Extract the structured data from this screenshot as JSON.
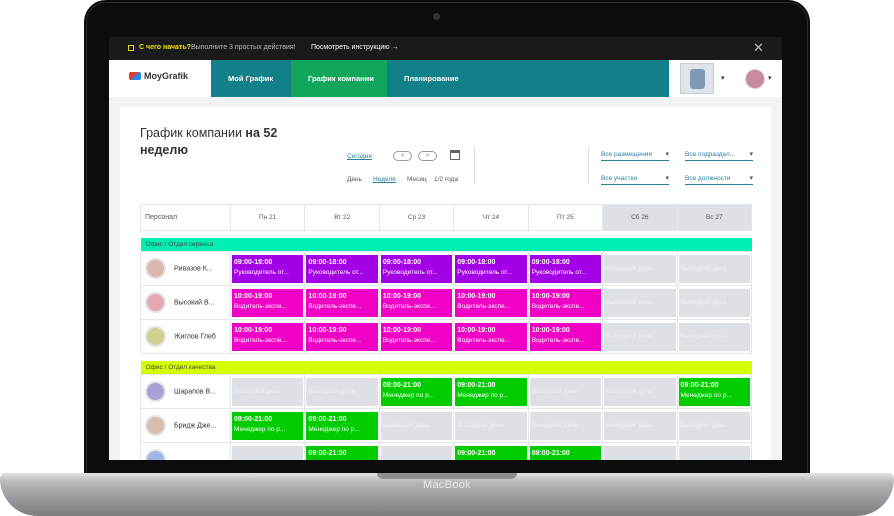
{
  "device": {
    "brand": "MacBook"
  },
  "topbar": {
    "question": "С чего начать?",
    "steps": "Выполните 3 простых действия!",
    "guide": "Посмотреть инструкцию →",
    "close": "✕"
  },
  "nav": {
    "logo": "MoyGrafik",
    "tabs": [
      {
        "label": "Мой График"
      },
      {
        "label": "График компании"
      },
      {
        "label": "Планирование"
      }
    ]
  },
  "page": {
    "title_plain": "График компании ",
    "title_bold": "на 52",
    "title_line2": "неделю",
    "today": "Сегодня",
    "prev": "<",
    "next": ">",
    "views": [
      "День",
      "Неделя",
      "Месяц",
      "1/2 года"
    ],
    "filters": [
      "Все размещения",
      "Все подраздел...",
      "Все участки",
      "Все должности"
    ]
  },
  "table": {
    "staff_header": "Персонал",
    "days": [
      "Пн 21",
      "Вт 22",
      "Ср 23",
      "Чт 24",
      "Пт 25",
      "Сб 26",
      "Вс 27"
    ],
    "sections": [
      {
        "name": "Офис / Отдел сервиса",
        "color": "#00f0b4",
        "rows": [
          {
            "name": "Ривазов К...",
            "shifts": [
              {
                "t": "09:00-18:00",
                "r": "Руководитель от...",
                "c": "purple"
              },
              {
                "t": "09:00-18:00",
                "r": "Руководитель от...",
                "c": "purple"
              },
              {
                "t": "09:00-18:00",
                "r": "Руководитель от...",
                "c": "purple"
              },
              {
                "t": "09:00-18:00",
                "r": "Руководитель от...",
                "c": "purple"
              },
              {
                "t": "09:00-18:00",
                "r": "Руководитель от...",
                "c": "purple"
              },
              {
                "t": "Выходной день",
                "c": "off"
              },
              {
                "t": "Выходной день",
                "c": "off"
              }
            ]
          },
          {
            "name": "Высокий В...",
            "shifts": [
              {
                "t": "10:00-19:00",
                "r": "Водитель-экспе...",
                "c": "pink"
              },
              {
                "t": "10:00-19:00",
                "r": "Водитель-экспе...",
                "c": "pink"
              },
              {
                "t": "10:00-19:00",
                "r": "Водитель-экспе...",
                "c": "pink"
              },
              {
                "t": "10:00-19:00",
                "r": "Водитель-экспе...",
                "c": "pink"
              },
              {
                "t": "10:00-19:00",
                "r": "Водитель-экспе...",
                "c": "pink"
              },
              {
                "t": "Выходной день",
                "c": "off"
              },
              {
                "t": "Выходной день",
                "c": "off"
              }
            ]
          },
          {
            "name": "Жиглов Глеб",
            "shifts": [
              {
                "t": "10:00-19:00",
                "r": "Водитель-экспе...",
                "c": "pink"
              },
              {
                "t": "10:00-19:00",
                "r": "Водитель-экспе...",
                "c": "pink"
              },
              {
                "t": "10:00-19:00",
                "r": "Водитель-экспе...",
                "c": "pink"
              },
              {
                "t": "10:00-19:00",
                "r": "Водитель-экспе...",
                "c": "pink"
              },
              {
                "t": "10:00-19:00",
                "r": "Водитель-экспе...",
                "c": "pink"
              },
              {
                "t": "Выходной день",
                "c": "off"
              },
              {
                "t": "Выходной день",
                "c": "off"
              }
            ]
          }
        ]
      },
      {
        "name": "Офис / Отдел качества",
        "color": "#d4ff00",
        "rows": [
          {
            "name": "Шарапов В...",
            "shifts": [
              {
                "t": "Выходной день",
                "c": "off"
              },
              {
                "t": "Выходной день",
                "c": "off"
              },
              {
                "t": "09:00-21:00",
                "r": "Менеджер по р...",
                "c": "green"
              },
              {
                "t": "09:00-21:00",
                "r": "Менеджер по р...",
                "c": "green"
              },
              {
                "t": "Выходной день",
                "c": "off"
              },
              {
                "t": "Выходной день",
                "c": "off"
              },
              {
                "t": "09:00-21:00",
                "r": "Менеджер по р...",
                "c": "green"
              }
            ]
          },
          {
            "name": "Бридж Дже...",
            "shifts": [
              {
                "t": "09:00-21:00",
                "r": "Менеджер по р...",
                "c": "green"
              },
              {
                "t": "09:00-21:00",
                "r": "Менеджер по р...",
                "c": "green"
              },
              {
                "t": "Выходной день",
                "c": "off"
              },
              {
                "t": "Выходной день",
                "c": "off"
              },
              {
                "t": "Выходной день",
                "c": "off"
              },
              {
                "t": "Выходной день",
                "c": "off"
              },
              {
                "t": "Выходной день",
                "c": "off"
              }
            ]
          },
          {
            "name": "",
            "shifts": [
              {
                "t": "",
                "c": "off"
              },
              {
                "t": "09:00-21:00",
                "r": "",
                "c": "green"
              },
              {
                "t": "",
                "c": "off"
              },
              {
                "t": "09:00-21:00",
                "r": "",
                "c": "green"
              },
              {
                "t": "09:00-21:00",
                "r": "",
                "c": "green"
              },
              {
                "t": "",
                "c": "off"
              },
              {
                "t": "",
                "c": "off"
              }
            ]
          }
        ]
      }
    ]
  }
}
